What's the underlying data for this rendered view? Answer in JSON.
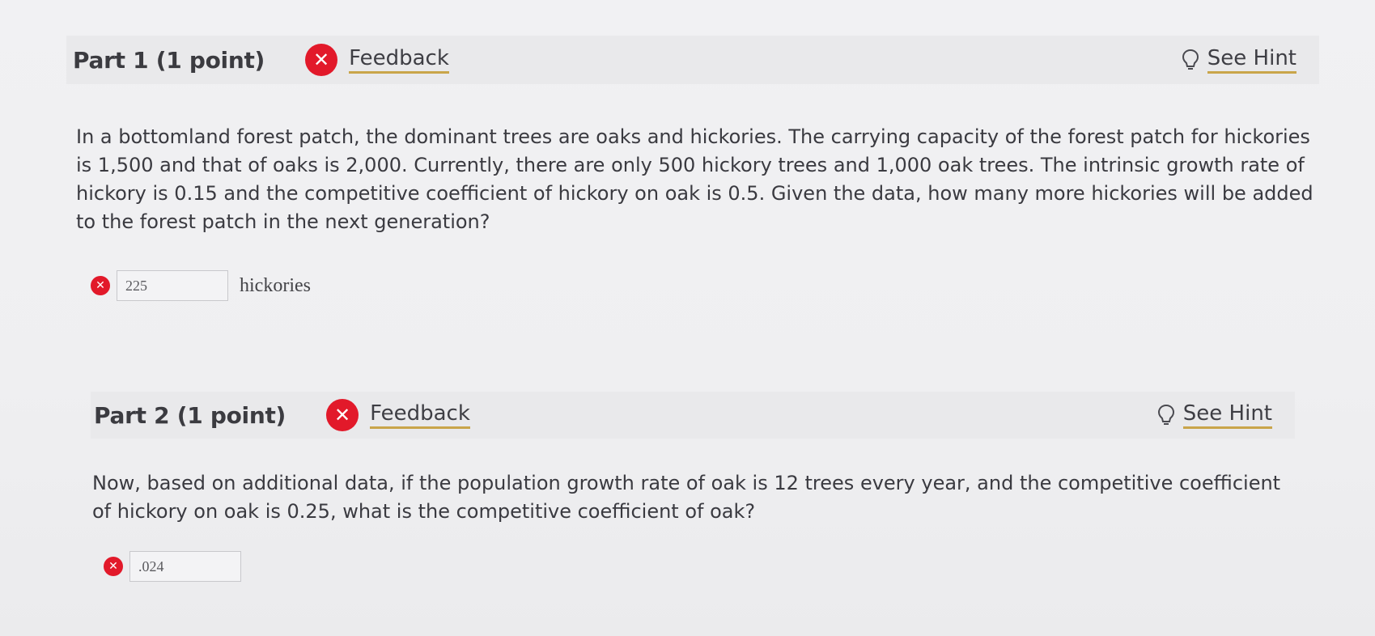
{
  "part1": {
    "title": "Part 1   (1 point)",
    "feedback_label": "Feedback",
    "hint_label": "See Hint",
    "question": "In a bottomland forest patch, the dominant trees are oaks and hickories. The carrying capacity of the forest patch for hickories is 1,500 and that of oaks is 2,000. Currently, there are only 500 hickory trees and 1,000 oak trees. The intrinsic growth rate of hickory is 0.15 and the competitive coefficient of hickory on oak is 0.5. Given the data, how many more hickories will be added to the forest patch in the next generation?",
    "answer_value": "225",
    "answer_unit": "hickories",
    "status": "incorrect"
  },
  "part2": {
    "title": "Part 2   (1 point)",
    "feedback_label": "Feedback",
    "hint_label": "See Hint",
    "question": "Now, based on additional data, if the population growth rate of oak is 12 trees every year, and the competitive coefficient of hickory on oak is 0.25, what is the competitive coefficient of oak?",
    "answer_value": ".024",
    "status": "incorrect"
  },
  "icons": {
    "incorrect": "close-circle-icon",
    "hint": "lightbulb-icon"
  },
  "colors": {
    "incorrect_red": "#e2192a",
    "link_underline": "#c9a54a",
    "header_bg": "#e9e9eb"
  }
}
